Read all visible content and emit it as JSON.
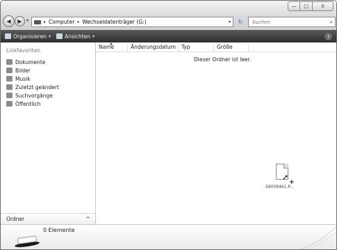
{
  "window": {
    "controls": {
      "minimize": "—",
      "maximize": "□",
      "close": "X"
    }
  },
  "address": {
    "crumbs": [
      "Computer",
      "Wechseldatenträger (G:)"
    ],
    "separator": "▸",
    "dropdown": "▾"
  },
  "nav_buttons": {
    "back": "◀",
    "forward": "▶",
    "dropdown": "▾"
  },
  "refresh": "↻",
  "search": {
    "placeholder": "Suchen",
    "icon": "search-icon"
  },
  "toolbar": {
    "organize_label": "Organisieren",
    "views_label": "Ansichten",
    "dropdown": "▾",
    "help_label": "?"
  },
  "navpane": {
    "header": "Linkfavoriten",
    "items": [
      {
        "label": "Dokumente",
        "icon": "documents-icon"
      },
      {
        "label": "Bilder",
        "icon": "pictures-icon"
      },
      {
        "label": "Musik",
        "icon": "music-icon"
      },
      {
        "label": "Zuletzt geändert",
        "icon": "recent-icon"
      },
      {
        "label": "Suchvorgänge",
        "icon": "searches-icon"
      },
      {
        "label": "Öffentlich",
        "icon": "public-icon"
      }
    ],
    "folder_label": "Ordner",
    "folder_caret": "^"
  },
  "filelist": {
    "columns": [
      "Name",
      "Änderungsdatum",
      "Typ",
      "Größe"
    ],
    "empty_message": "Dieser Ordner ist leer."
  },
  "drag": {
    "filename": "S9009461.P..."
  },
  "details": {
    "item_count": "0 Elemente"
  }
}
